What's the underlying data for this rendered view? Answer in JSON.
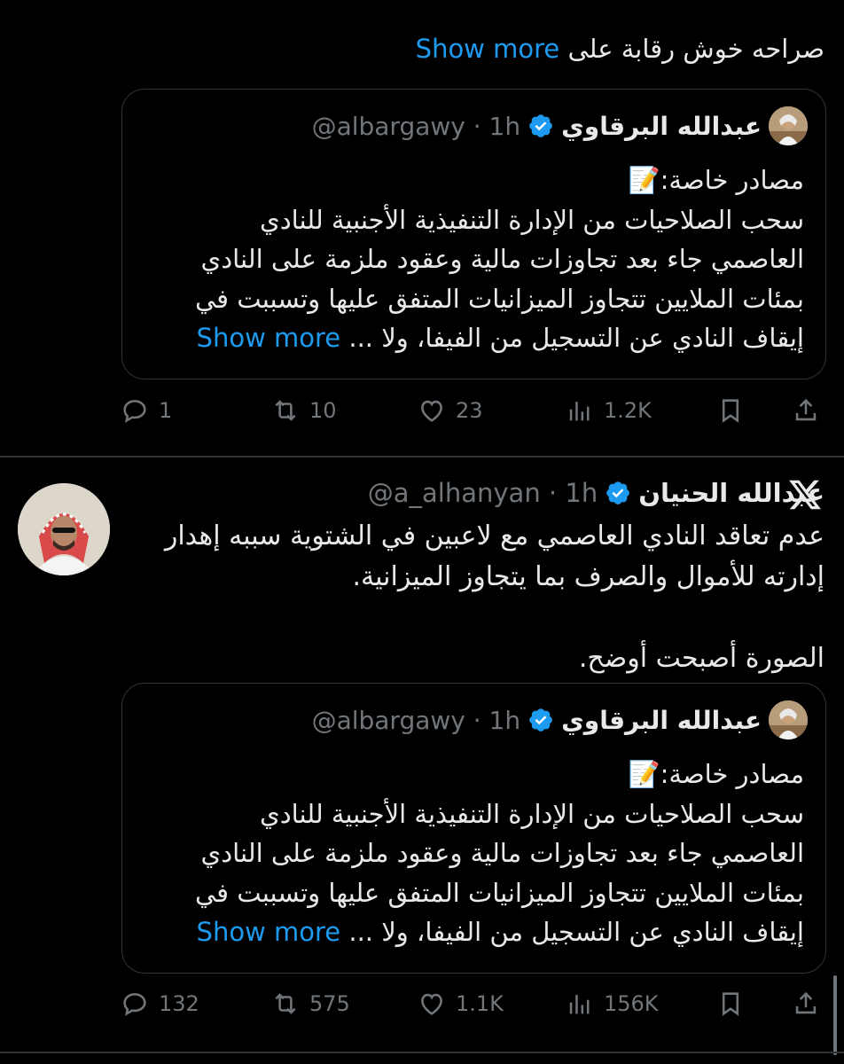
{
  "top_tweet": {
    "text_prefix": "صراحه خوش رقابة على ",
    "show_more": "Show more"
  },
  "quote": {
    "name": "عبدالله البرقاوي",
    "handle": "@albargawy · 1h",
    "emoji": "📝",
    "lines": [
      "مصادر خاصة:",
      "سحب الصلاحيات من الإدارة التنفيذية الأجنبية للنادي",
      "العاصمي جاء بعد تجاوزات مالية وعقود ملزمة على النادي",
      "بمئات الملايين تتجاوز الميزانيات المتفق عليها وتسببت في",
      "إيقاف النادي عن التسجيل من الفيفا، ولا ... "
    ],
    "show_more": "Show more"
  },
  "actions_1": {
    "replies": "1",
    "reposts": "10",
    "likes": "23",
    "views": "1.2K"
  },
  "main_tweet": {
    "name": "عبدالله الحنيان",
    "handle": "@a_alhanyan · 1h",
    "lines": [
      "عدم تعاقد النادي العاصمي مع لاعبين في الشتوية سببه إهدار",
      "إدارته للأموال والصرف بما يتجاوز الميزانية.",
      "",
      "الصورة أصبحت أوضح."
    ]
  },
  "actions_2": {
    "replies": "132",
    "reposts": "575",
    "likes": "1.1K",
    "views": "156K"
  },
  "icons": {
    "reply": "reply-icon",
    "repost": "repost-icon",
    "like": "heart-icon",
    "views": "views-icon",
    "bookmark": "bookmark-icon",
    "share": "share-icon",
    "verified": "verified-icon",
    "x_logo": "x-logo-icon"
  },
  "colors": {
    "background": "#000000",
    "text": "#e7e9ea",
    "muted": "#71767b",
    "link": "#1d9bf0",
    "border": "#2f3336"
  }
}
